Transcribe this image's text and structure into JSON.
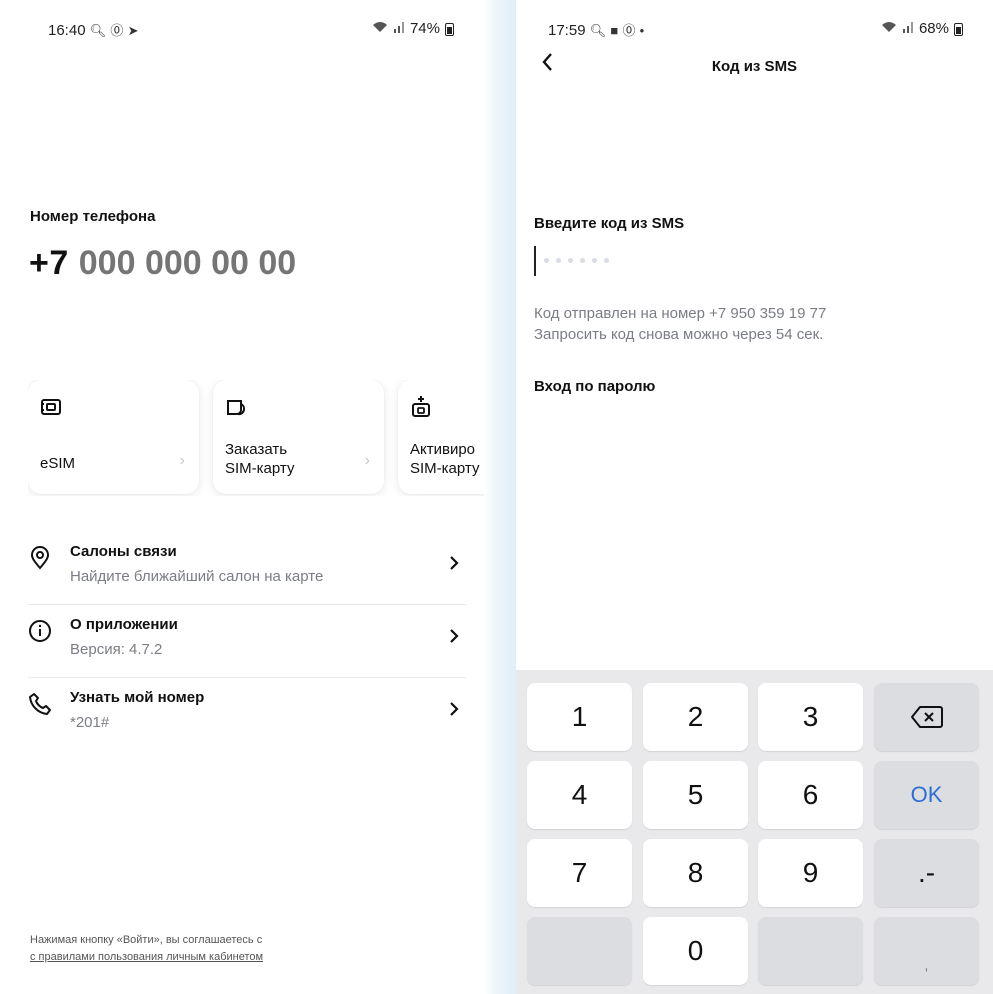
{
  "left": {
    "status": {
      "time": "16:40",
      "battery": "74%"
    },
    "phone_label": "Номер телефона",
    "phone_prefix": "+7",
    "phone_placeholder": "000 000 00 00",
    "cards": [
      {
        "label_line1": "eSIM",
        "label_line2": ""
      },
      {
        "label_line1": "Заказать",
        "label_line2": "SIM-карту"
      },
      {
        "label_line1": "Активиро",
        "label_line2": "SIM-карту"
      }
    ],
    "menu": [
      {
        "title": "Салоны связи",
        "subtitle": "Найдите ближайший салон на карте",
        "icon": "location-pin-icon"
      },
      {
        "title": "О приложении",
        "subtitle": "Версия: 4.7.2",
        "icon": "info-icon"
      },
      {
        "title": "Узнать мой номер",
        "subtitle": "*201#",
        "icon": "phone-icon"
      }
    ],
    "legal_text": "Нажимая кнопку «Войти», вы соглашаетесь с",
    "legal_link": "с правилами пользования личным кабинетом"
  },
  "right": {
    "status": {
      "time": "17:59",
      "battery": "68%"
    },
    "title": "Код из SMS",
    "code_label": "Введите код из SMS",
    "info_line1": "Код отправлен на номер +7 950 359 19 77",
    "info_line2": "Запросить код снова можно через 54 сек.",
    "password_login": "Вход по паролю",
    "keys": [
      "1",
      "2",
      "3",
      "4",
      "5",
      "6",
      "OK",
      "7",
      "8",
      "9",
      ".-",
      "0",
      ","
    ]
  },
  "colors": {
    "placeholder": "#e7e8ec",
    "ok_key": "#2b6fd6",
    "keyboard_bg": "#e9e9ec"
  }
}
